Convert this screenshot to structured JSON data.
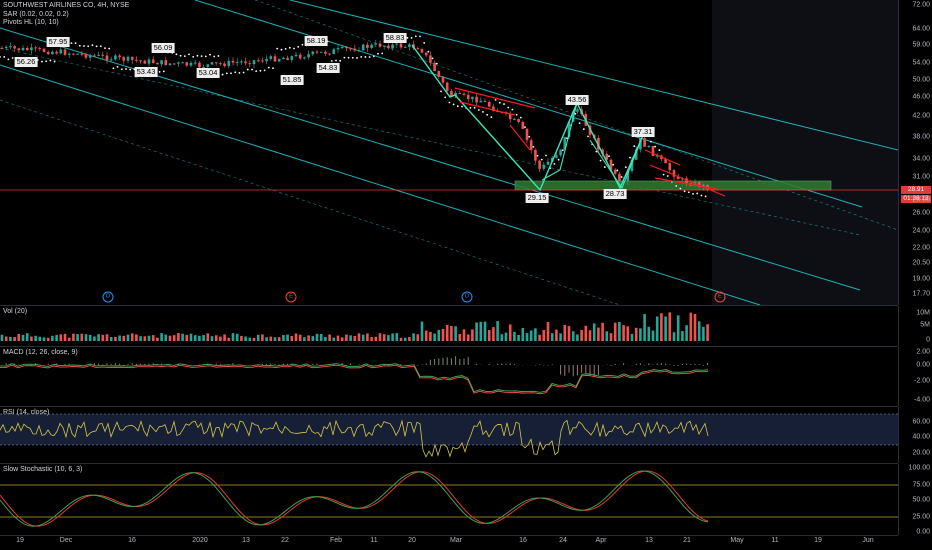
{
  "symbol": {
    "title": "SOUTHWEST AIRLINES CO, 4H, NYSE",
    "indicator_sar": "SAR (0.02, 0.02, 0.2)",
    "indicator_pivots": "Pivots HL (10, 10)"
  },
  "price_axis": {
    "ticks": [
      "72.00",
      "64.00",
      "59.00",
      "54.00",
      "50.00",
      "46.00",
      "42.00",
      "38.00",
      "34.00",
      "31.00",
      "28.00",
      "26.00",
      "24.00",
      "22.00",
      "20.50",
      "19.00",
      "17.70"
    ],
    "last_price": "28.91",
    "countdown": "01:28:13"
  },
  "pivots": [
    {
      "label": "56.26",
      "type": "low"
    },
    {
      "label": "57.95",
      "type": "high"
    },
    {
      "label": "56.09",
      "type": "high"
    },
    {
      "label": "53.43",
      "type": "low"
    },
    {
      "label": "53.04",
      "type": "low"
    },
    {
      "label": "51.85",
      "type": "low"
    },
    {
      "label": "58.19",
      "type": "high"
    },
    {
      "label": "54.83",
      "type": "low"
    },
    {
      "label": "58.83",
      "type": "high"
    },
    {
      "label": "43.56",
      "type": "high"
    },
    {
      "label": "29.15",
      "type": "low"
    },
    {
      "label": "28.73",
      "type": "low"
    },
    {
      "label": "37.31",
      "type": "high"
    }
  ],
  "events": [
    {
      "label": "D",
      "color": "#2196f3"
    },
    {
      "label": "E",
      "color": "#f44336"
    },
    {
      "label": "D",
      "color": "#2196f3"
    },
    {
      "label": "E",
      "color": "#f44336"
    }
  ],
  "volume": {
    "legend": "Vol (20)",
    "ticks": [
      "10M",
      "5M",
      "0"
    ]
  },
  "macd": {
    "legend": "MACD (12, 26, close, 9)",
    "ticks": [
      "2.00",
      "0.00",
      "-2.00",
      "-4.00"
    ]
  },
  "rsi": {
    "legend": "RSI (14, close)",
    "ticks": [
      "60.00",
      "40.00",
      "20.00"
    ]
  },
  "stoch": {
    "legend": "Slow Stochastic (10, 6, 3)",
    "ticks": [
      "100.00",
      "75.00",
      "50.00",
      "25.00",
      "0.00"
    ]
  },
  "time_axis": [
    "19",
    "Dec",
    "16",
    "2020",
    "13",
    "22",
    "Feb",
    "11",
    "20",
    "Mar",
    "16",
    "24",
    "Apr",
    "13",
    "21",
    "May",
    "11",
    "19",
    "Jun"
  ],
  "colors": {
    "up": "#26a69a",
    "down": "#ef5350",
    "channel": "#1fc4c9",
    "support_zone": "#2e7d32",
    "sar": "#ffffff",
    "zigzag": "#3ee6b8",
    "wedge": "#ff1a1a",
    "macd_line": "#4caf50",
    "signal_line": "#ff5252",
    "rsi_line": "#d4c84a",
    "stoch_k": "#43a047",
    "stoch_d": "#e53935"
  }
}
